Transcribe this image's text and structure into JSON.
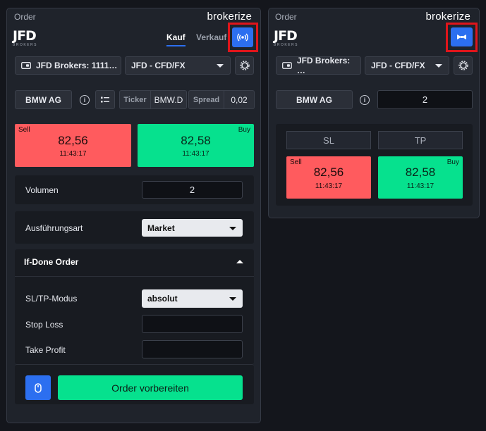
{
  "left": {
    "title": "Order",
    "brand": {
      "pre": "broker",
      "z": "i",
      "post": "ze"
    },
    "logo": {
      "main": "JFD",
      "sub": "BROKERS"
    },
    "tabs": [
      {
        "label": "Kauf",
        "active": true
      },
      {
        "label": "Verkauf",
        "active": false
      }
    ],
    "account_label": "JFD Brokers: 1111…",
    "market_select": "JFD - CFD/FX",
    "symbol": "BMW AG",
    "ticker_label": "Ticker",
    "ticker_value": "BMW.D",
    "spread_label": "Spread",
    "spread_value": "0,02",
    "sell": {
      "tag": "Sell",
      "price": "82,56",
      "time": "11:43:17"
    },
    "buy": {
      "tag": "Buy",
      "price": "82,58",
      "time": "11:43:17"
    },
    "volume_label": "Volumen",
    "volume_value": "2",
    "exec_label": "Ausführungsart",
    "exec_value": "Market",
    "ifdone_label": "If-Done Order",
    "sltp_mode_label": "SL/TP-Modus",
    "sltp_mode_value": "absolut",
    "stoploss_label": "Stop Loss",
    "stoploss_value": "",
    "takeprofit_label": "Take Profit",
    "takeprofit_value": "",
    "submit_label": "Order vorbereiten"
  },
  "right": {
    "title": "Order",
    "brand": {
      "pre": "broker",
      "z": "i",
      "post": "ze"
    },
    "logo": {
      "main": "JFD",
      "sub": "BROKERS"
    },
    "account_label": "JFD Brokers: …",
    "market_select": "JFD - CFD/FX",
    "symbol": "BMW AG",
    "quantity_value": "2",
    "sl_label": "SL",
    "tp_label": "TP",
    "sell": {
      "tag": "Sell",
      "price": "82,56",
      "time": "11:43:17"
    },
    "buy": {
      "tag": "Buy",
      "price": "82,58",
      "time": "11:43:17"
    }
  },
  "colors": {
    "sell": "#ff5b5e",
    "buy": "#06e18e",
    "accent": "#2c6ff0",
    "highlight": "#e0151b"
  },
  "icons": [
    "broadcast-icon",
    "bowtie-icon",
    "wallet-icon",
    "gear-icon",
    "info-icon",
    "list-icon",
    "mouse-icon",
    "chevron-up-icon",
    "caret-down-icon"
  ]
}
